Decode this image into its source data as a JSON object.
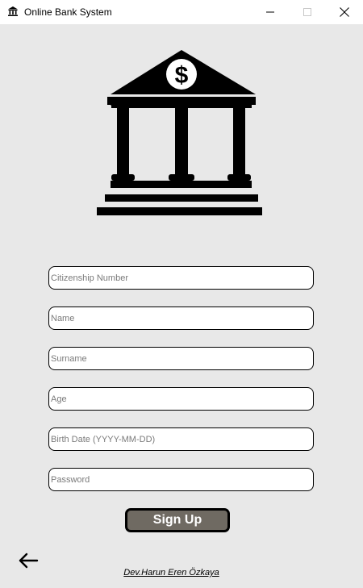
{
  "window": {
    "title": "Online Bank System",
    "icon": "bank-icon",
    "controls": [
      "minimize-icon",
      "maximize-icon",
      "close-icon"
    ]
  },
  "logo": {
    "icon": "bank-building-icon",
    "symbol": "$"
  },
  "form": {
    "citizenship_placeholder": "Citizenship Number",
    "name_placeholder": "Name",
    "surname_placeholder": "Surname",
    "age_placeholder": "Age",
    "birthdate_placeholder": "Birth Date (YYYY-MM-DD)",
    "password_placeholder": "Password",
    "citizenship_value": "",
    "name_value": "",
    "surname_value": "",
    "age_value": "",
    "birthdate_value": "",
    "password_value": ""
  },
  "actions": {
    "signup_label": "Sign Up",
    "back_icon": "arrow-left-icon"
  },
  "footer": {
    "credit": "Dev.Harun Eren Özkaya"
  },
  "colors": {
    "background": "#e8e8e8",
    "titlebar": "#ffffff",
    "button_fill": "#6f6a62",
    "button_text": "#ffffff"
  }
}
